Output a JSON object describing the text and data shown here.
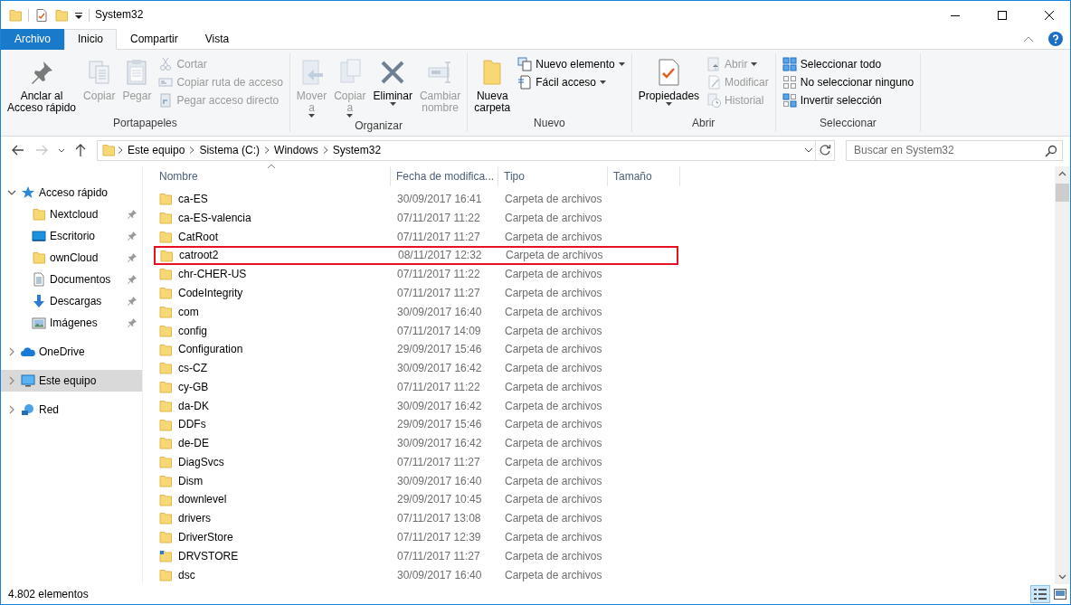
{
  "window": {
    "title": "System32"
  },
  "tabs": [
    {
      "label": "Archivo",
      "kind": "file",
      "selected": false
    },
    {
      "label": "Inicio",
      "kind": "tab",
      "selected": true
    },
    {
      "label": "Compartir",
      "kind": "tab",
      "selected": false
    },
    {
      "label": "Vista",
      "kind": "tab",
      "selected": false
    }
  ],
  "ribbon": {
    "groups": [
      {
        "label": "Portapapeles",
        "items": [
          {
            "kind": "large",
            "label": "Anclar al\nAcceso rápido",
            "disabled": false,
            "dropdown": false
          },
          {
            "kind": "large",
            "label": "Copiar",
            "disabled": true,
            "dropdown": false
          },
          {
            "kind": "large",
            "label": "Pegar",
            "disabled": true,
            "dropdown": false
          },
          {
            "kind": "small",
            "label": "Cortar",
            "disabled": true,
            "dropdown": false
          },
          {
            "kind": "small",
            "label": "Copiar ruta de acceso",
            "disabled": true,
            "dropdown": false
          },
          {
            "kind": "small",
            "label": "Pegar acceso directo",
            "disabled": true,
            "dropdown": false
          }
        ]
      },
      {
        "label": "Organizar",
        "items": [
          {
            "kind": "large",
            "label": "Mover\na",
            "disabled": true,
            "dropdown": true
          },
          {
            "kind": "large",
            "label": "Copiar\na",
            "disabled": true,
            "dropdown": true
          },
          {
            "kind": "large",
            "label": "Eliminar",
            "disabled": false,
            "dropdown": true
          },
          {
            "kind": "large",
            "label": "Cambiar\nnombre",
            "disabled": true,
            "dropdown": false
          }
        ]
      },
      {
        "label": "Nuevo",
        "items": [
          {
            "kind": "large",
            "label": "Nueva\ncarpeta",
            "disabled": false,
            "dropdown": false
          },
          {
            "kind": "small",
            "label": "Nuevo elemento",
            "disabled": false,
            "dropdown": true
          },
          {
            "kind": "small",
            "label": "Fácil acceso",
            "disabled": false,
            "dropdown": true
          }
        ]
      },
      {
        "label": "Abrir",
        "items": [
          {
            "kind": "large",
            "label": "Propiedades",
            "disabled": false,
            "dropdown": true
          },
          {
            "kind": "small",
            "label": "Abrir",
            "disabled": true,
            "dropdown": true
          },
          {
            "kind": "small",
            "label": "Modificar",
            "disabled": true,
            "dropdown": false
          },
          {
            "kind": "small",
            "label": "Historial",
            "disabled": true,
            "dropdown": false
          }
        ]
      },
      {
        "label": "Seleccionar",
        "items": [
          {
            "kind": "small",
            "label": "Seleccionar todo",
            "disabled": false,
            "dropdown": false
          },
          {
            "kind": "small",
            "label": "No seleccionar ninguno",
            "disabled": false,
            "dropdown": false
          },
          {
            "kind": "small",
            "label": "Invertir selección",
            "disabled": false,
            "dropdown": false
          }
        ]
      }
    ]
  },
  "address": {
    "back_disabled": false,
    "forward_disabled": true,
    "breadcrumbs": [
      "Este equipo",
      "Sistema (C:)",
      "Windows",
      "System32"
    ]
  },
  "search": {
    "placeholder": "Buscar en System32"
  },
  "sidebar": {
    "items": [
      {
        "label": "Acceso rápido",
        "expanded": true,
        "selected": false,
        "children": [
          {
            "label": "Nextcloud",
            "pinned": true,
            "selected": false
          },
          {
            "label": "Escritorio",
            "pinned": true,
            "selected": false
          },
          {
            "label": "ownCloud",
            "pinned": true,
            "selected": false
          },
          {
            "label": "Documentos",
            "pinned": true,
            "selected": false
          },
          {
            "label": "Descargas",
            "pinned": true,
            "selected": false
          },
          {
            "label": "Imágenes",
            "pinned": true,
            "selected": false
          }
        ]
      },
      {
        "label": "OneDrive",
        "expanded": false,
        "selected": false
      },
      {
        "label": "Este equipo",
        "expanded": false,
        "selected": true
      },
      {
        "label": "Red",
        "expanded": false,
        "selected": false
      }
    ]
  },
  "table": {
    "columns": [
      "Nombre",
      "Fecha de modifica...",
      "Tipo",
      "Tamaño"
    ],
    "rows": [
      {
        "name": "ca-ES",
        "date": "30/09/2017 16:41",
        "type": "Carpeta de archivos",
        "kind": "folder",
        "highlighted": false
      },
      {
        "name": "ca-ES-valencia",
        "date": "07/11/2017 11:22",
        "type": "Carpeta de archivos",
        "kind": "folder",
        "highlighted": false
      },
      {
        "name": "CatRoot",
        "date": "07/11/2017 11:27",
        "type": "Carpeta de archivos",
        "kind": "folder",
        "highlighted": false
      },
      {
        "name": "catroot2",
        "date": "08/11/2017 12:32",
        "type": "Carpeta de archivos",
        "kind": "folder",
        "highlighted": true
      },
      {
        "name": "chr-CHER-US",
        "date": "07/11/2017 11:22",
        "type": "Carpeta de archivos",
        "kind": "folder",
        "highlighted": false
      },
      {
        "name": "CodeIntegrity",
        "date": "07/11/2017 11:27",
        "type": "Carpeta de archivos",
        "kind": "folder",
        "highlighted": false
      },
      {
        "name": "com",
        "date": "30/09/2017 16:40",
        "type": "Carpeta de archivos",
        "kind": "folder",
        "highlighted": false
      },
      {
        "name": "config",
        "date": "07/11/2017 14:09",
        "type": "Carpeta de archivos",
        "kind": "folder",
        "highlighted": false
      },
      {
        "name": "Configuration",
        "date": "29/09/2017 15:46",
        "type": "Carpeta de archivos",
        "kind": "folder",
        "highlighted": false
      },
      {
        "name": "cs-CZ",
        "date": "30/09/2017 16:42",
        "type": "Carpeta de archivos",
        "kind": "folder",
        "highlighted": false
      },
      {
        "name": "cy-GB",
        "date": "07/11/2017 11:22",
        "type": "Carpeta de archivos",
        "kind": "folder",
        "highlighted": false
      },
      {
        "name": "da-DK",
        "date": "30/09/2017 16:42",
        "type": "Carpeta de archivos",
        "kind": "folder",
        "highlighted": false
      },
      {
        "name": "DDFs",
        "date": "29/09/2017 15:46",
        "type": "Carpeta de archivos",
        "kind": "folder",
        "highlighted": false
      },
      {
        "name": "de-DE",
        "date": "30/09/2017 16:42",
        "type": "Carpeta de archivos",
        "kind": "folder",
        "highlighted": false
      },
      {
        "name": "DiagSvcs",
        "date": "07/11/2017 11:27",
        "type": "Carpeta de archivos",
        "kind": "folder",
        "highlighted": false
      },
      {
        "name": "Dism",
        "date": "30/09/2017 16:40",
        "type": "Carpeta de archivos",
        "kind": "folder",
        "highlighted": false
      },
      {
        "name": "downlevel",
        "date": "29/09/2017 10:45",
        "type": "Carpeta de archivos",
        "kind": "folder",
        "highlighted": false
      },
      {
        "name": "drivers",
        "date": "07/11/2017 13:08",
        "type": "Carpeta de archivos",
        "kind": "folder",
        "highlighted": false
      },
      {
        "name": "DriverStore",
        "date": "07/11/2017 12:39",
        "type": "Carpeta de archivos",
        "kind": "folder",
        "highlighted": false
      },
      {
        "name": "DRVSTORE",
        "date": "07/11/2017 11:27",
        "type": "Carpeta de archivos",
        "kind": "special-folder",
        "highlighted": false
      },
      {
        "name": "dsc",
        "date": "30/09/2017 16:40",
        "type": "Carpeta de archivos",
        "kind": "folder",
        "highlighted": false
      }
    ]
  },
  "status_bar": {
    "count": "4.802 elementos",
    "views": [
      {
        "kind": "details",
        "selected": true
      },
      {
        "kind": "large-icons",
        "selected": false
      }
    ]
  }
}
